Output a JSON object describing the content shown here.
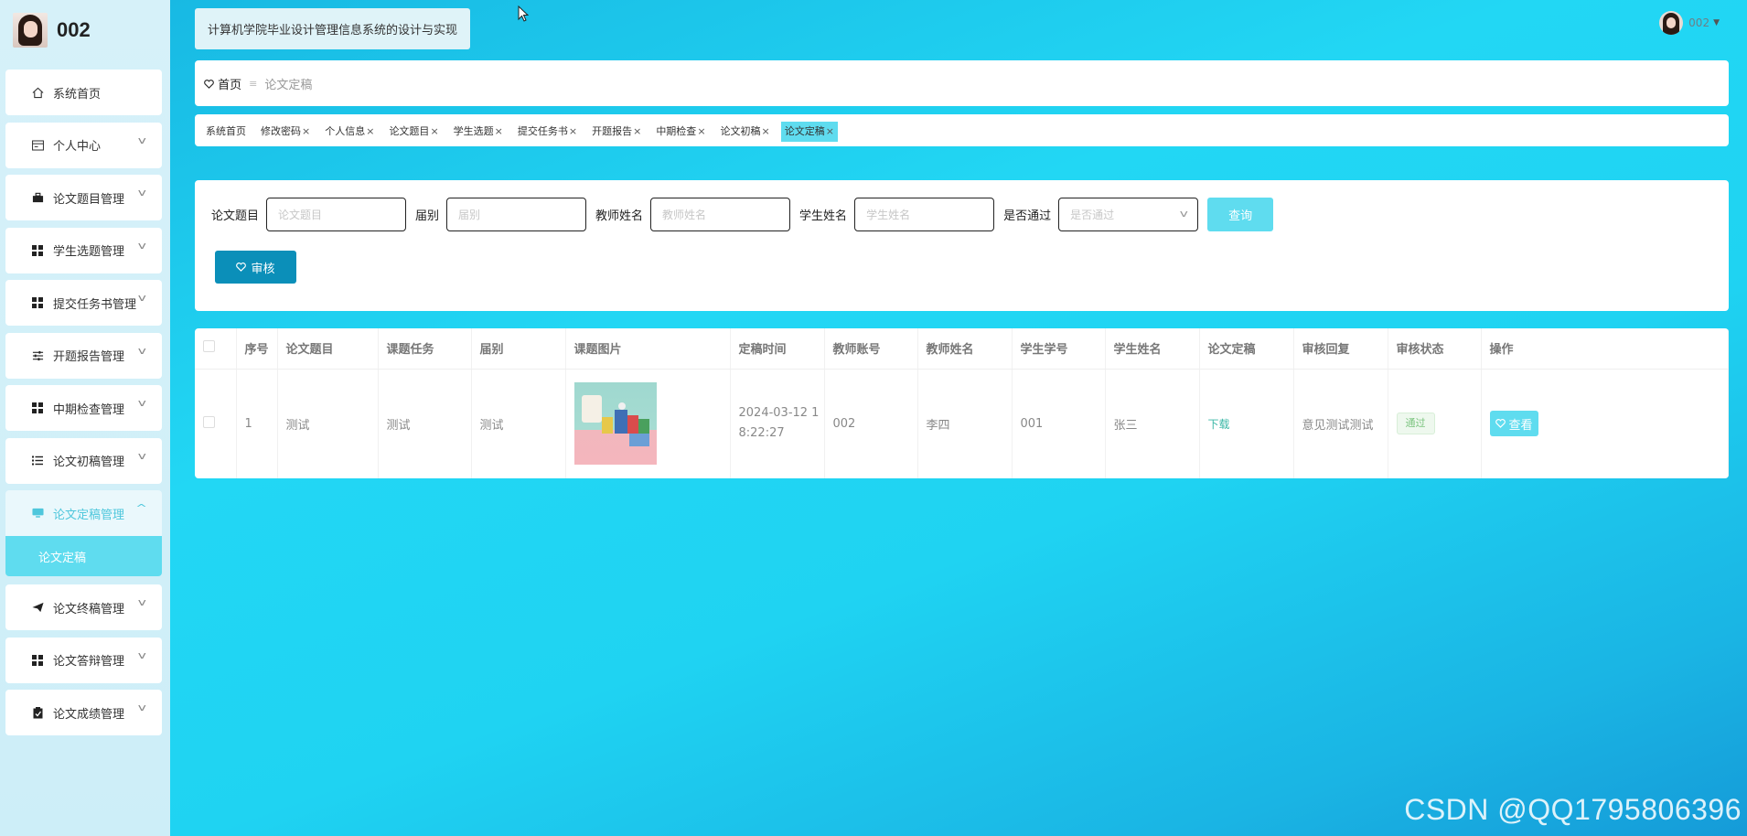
{
  "brand": {
    "name": "002"
  },
  "sidebar": {
    "items": [
      {
        "label": "系统首页",
        "icon": "home-icon",
        "chevron": false
      },
      {
        "label": "个人中心",
        "icon": "id-card-icon",
        "chevron": true
      },
      {
        "label": "论文题目管理",
        "icon": "briefcase-icon",
        "chevron": true
      },
      {
        "label": "学生选题管理",
        "icon": "grid-icon",
        "chevron": true
      },
      {
        "label": "提交任务书管理",
        "icon": "grid-icon",
        "chevron": true
      },
      {
        "label": "开题报告管理",
        "icon": "sliders-icon",
        "chevron": true
      },
      {
        "label": "中期检查管理",
        "icon": "grid-icon",
        "chevron": true
      },
      {
        "label": "论文初稿管理",
        "icon": "list-icon",
        "chevron": true
      },
      {
        "label": "论文定稿管理",
        "icon": "monitor-icon",
        "chevron": true,
        "active": true,
        "sub": "论文定稿"
      },
      {
        "label": "论文终稿管理",
        "icon": "send-icon",
        "chevron": true
      },
      {
        "label": "论文答辩管理",
        "icon": "grid-icon",
        "chevron": true
      },
      {
        "label": "论文成绩管理",
        "icon": "clipboard-icon",
        "chevron": true
      }
    ]
  },
  "header": {
    "title": "计算机学院毕业设计管理信息系统的设计与实现",
    "user": "002"
  },
  "breadcrumb": {
    "home": "首页",
    "separator": "≡",
    "current": "论文定稿"
  },
  "tabs": [
    {
      "label": "系统首页",
      "closable": false
    },
    {
      "label": "修改密码",
      "closable": true
    },
    {
      "label": "个人信息",
      "closable": true
    },
    {
      "label": "论文题目",
      "closable": true
    },
    {
      "label": "学生选题",
      "closable": true
    },
    {
      "label": "提交任务书",
      "closable": true
    },
    {
      "label": "开题报告",
      "closable": true
    },
    {
      "label": "中期检查",
      "closable": true
    },
    {
      "label": "论文初稿",
      "closable": true
    },
    {
      "label": "论文定稿",
      "closable": true,
      "active": true
    }
  ],
  "search": {
    "fields": [
      {
        "label": "论文题目",
        "placeholder": "论文题目"
      },
      {
        "label": "届别",
        "placeholder": "届别"
      },
      {
        "label": "教师姓名",
        "placeholder": "教师姓名"
      },
      {
        "label": "学生姓名",
        "placeholder": "学生姓名"
      },
      {
        "label": "是否通过",
        "placeholder": "是否通过",
        "select": true
      }
    ],
    "query_label": "查询",
    "audit_label": "审核"
  },
  "table": {
    "columns": [
      "",
      "序号",
      "论文题目",
      "课题任务",
      "届别",
      "课题图片",
      "定稿时间",
      "教师账号",
      "教师姓名",
      "学生学号",
      "学生姓名",
      "论文定稿",
      "审核回复",
      "审核状态",
      "操作"
    ],
    "rows": [
      {
        "index": "1",
        "title": "测试",
        "task": "测试",
        "session": "测试",
        "time": "2024-03-12 18:22:27",
        "teacher_account": "002",
        "teacher_name": "李四",
        "student_id": "001",
        "student_name": "张三",
        "file_link": "下载",
        "reply": "意见测试测试",
        "status": "通过",
        "action": "查看"
      }
    ]
  },
  "watermark": "CSDN @QQ1795806396",
  "colors": {
    "accent": "#5fdcef",
    "primary_button": "#0b8fb9",
    "main_bg": "#1fd3f2"
  }
}
